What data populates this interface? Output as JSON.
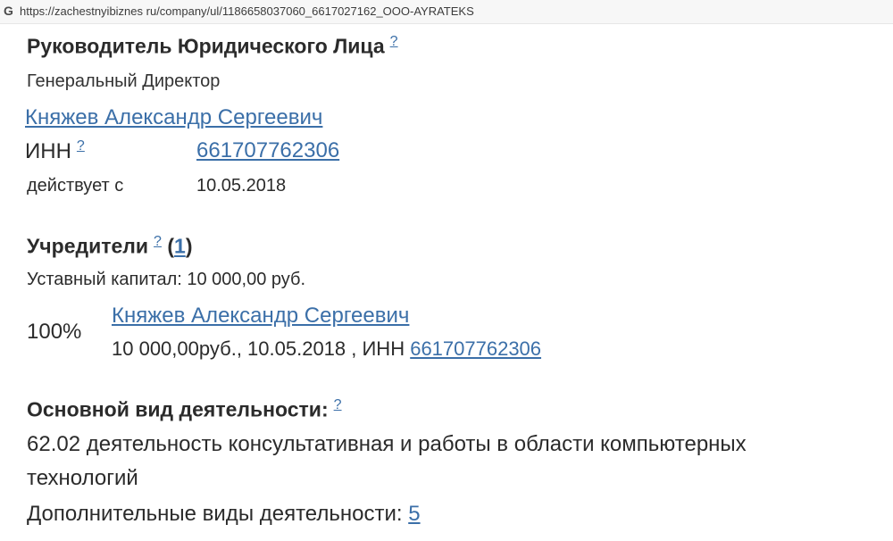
{
  "browser": {
    "url": "https://zachestnyibiznes ru/company/ul/1186658037060_6617027162_OOO-AYRATEKS",
    "icon": "google-g-icon"
  },
  "head_section": {
    "title": "Руководитель Юридического Лица",
    "help": "?",
    "position": "Генеральный Директор",
    "name": "Княжев Александр Сергеевич",
    "inn_label": "ИНН",
    "inn_help": "?",
    "inn_value": "661707762306",
    "since_label": "действует с",
    "since_value": "10.05.2018"
  },
  "founders": {
    "title": "Учредители",
    "help": "?",
    "count_open": "(",
    "count": "1",
    "count_close": ")",
    "capital": "Уставный капитал: 10 000,00 руб.",
    "share": "100%",
    "name": "Княжев Александр Сергеевич",
    "details_prefix": "10 000,00руб., 10.05.2018 , ИНН ",
    "inn": "661707762306"
  },
  "activity": {
    "title": "Основной вид деятельности:",
    "help": "?",
    "main_line1": "62.02 деятельность консультативная и работы в области компьютерных",
    "main_line2": "технологий",
    "extra_label": "Дополнительные виды деятельности: ",
    "extra_count": "5"
  }
}
